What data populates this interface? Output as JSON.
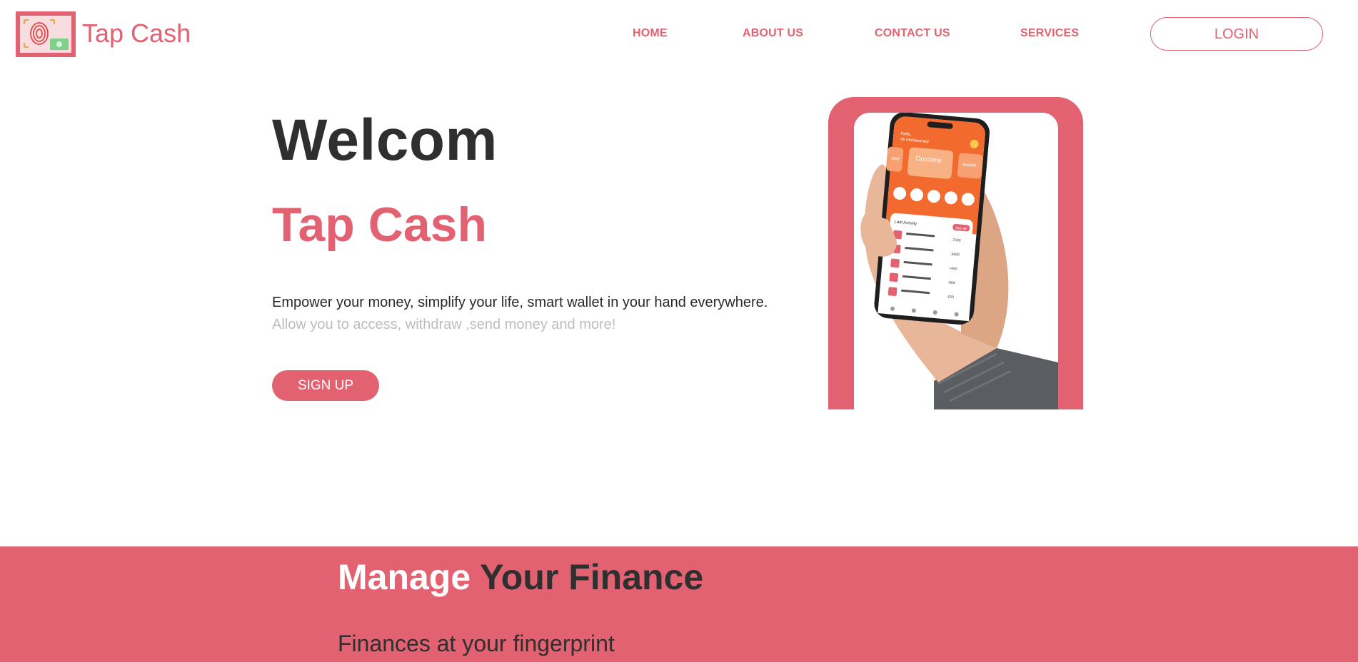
{
  "brand": {
    "name": "Tap Cash",
    "accent_color": "#e26272",
    "logo_icon": "fingerprint-cash-icon"
  },
  "nav": {
    "items": [
      {
        "label": "HOME"
      },
      {
        "label": "ABOUT US"
      },
      {
        "label": "CONTACT US"
      },
      {
        "label": "SERVICES"
      }
    ],
    "login_label": "LOGIN"
  },
  "hero": {
    "title": "Welcom",
    "brand": "Tap Cash",
    "description": "Empower your money, simplify your life, smart wallet in your hand everywhere.",
    "subtext": "Allow you to access, withdraw ,send money and more!",
    "signup_label": "SIGN UP"
  },
  "phone_screen": {
    "greeting_line1": "Hello,",
    "greeting_line2": "Ali Mohammed",
    "card_left": "nse",
    "card_center": "Outcome",
    "card_right": "Incom",
    "section_label": "Last Activity",
    "see_all": "See all",
    "activity": [
      {
        "amount": "-7500"
      },
      {
        "amount": "-3600"
      },
      {
        "amount": "+450"
      },
      {
        "amount": "-600"
      },
      {
        "amount": "-150"
      }
    ]
  },
  "bottom": {
    "title_word1": "Manage",
    "title_word2": "Your Finance",
    "subtitle": "Finances at your fingerprint"
  }
}
